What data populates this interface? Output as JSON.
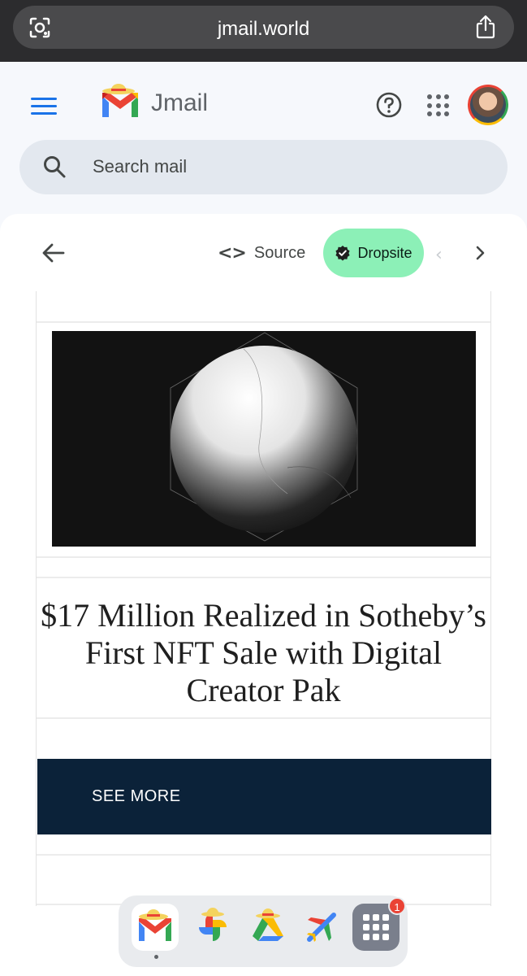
{
  "browser": {
    "url": "jmail.world"
  },
  "header": {
    "brand": "Jmail",
    "search_placeholder": "Search mail"
  },
  "toolbar": {
    "source_label": "Source",
    "dropsite_label": "Dropsite"
  },
  "email": {
    "headline": "$17 Million Realized in Sotheby’s First NFT Sale with Digital Creator Pak",
    "cta_label": "SEE MORE"
  },
  "dock": {
    "apps": [
      "jmail",
      "photos",
      "drive",
      "flights",
      "app-launcher"
    ],
    "launcher_badge": "1"
  },
  "colors": {
    "accent": "#1a73e8",
    "dropsite_bg": "#8cf0b7",
    "cta_bg": "#0b2239"
  }
}
